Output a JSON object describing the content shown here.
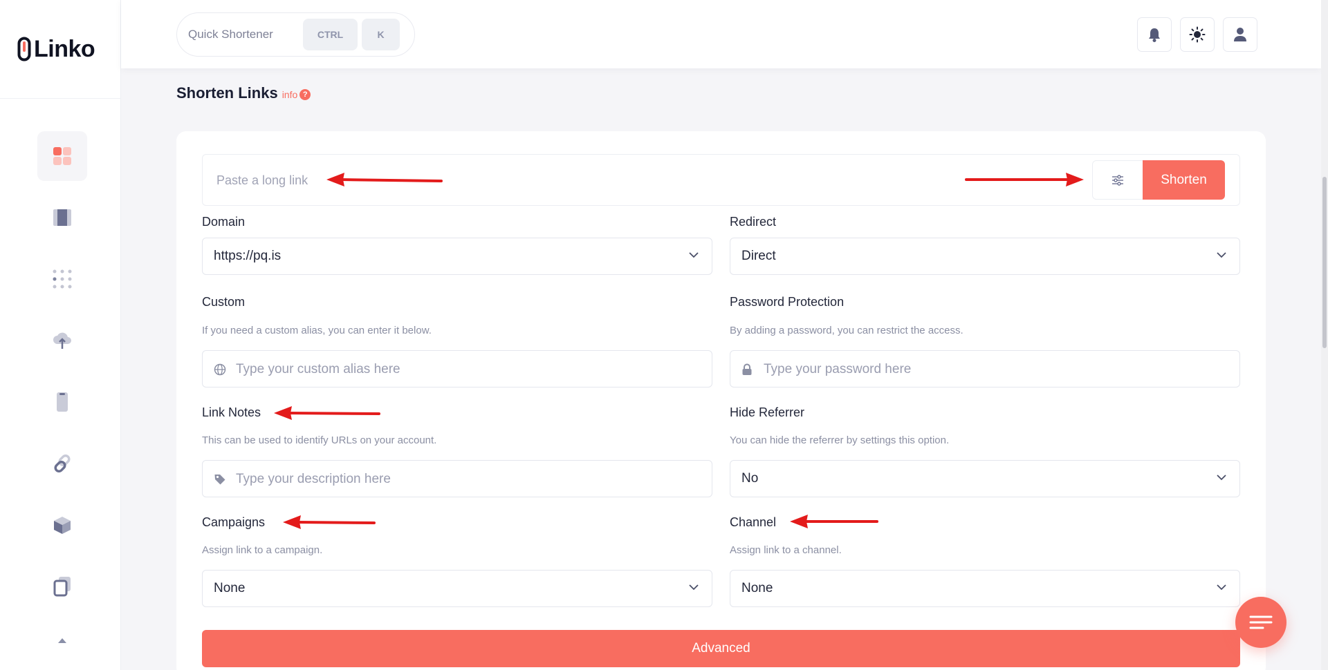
{
  "app": {
    "name": "Linko"
  },
  "topbar": {
    "quick_shortener_label": "Quick Shortener",
    "shortcut_ctrl": "CTRL",
    "shortcut_k": "K"
  },
  "page": {
    "title": "Shorten Links",
    "info_label": "info",
    "info_badge": "?"
  },
  "shorten_bar": {
    "placeholder": "Paste a long link",
    "shorten_label": "Shorten"
  },
  "form": {
    "domain": {
      "label": "Domain",
      "value": "https://pq.is"
    },
    "redirect": {
      "label": "Redirect",
      "value": "Direct"
    },
    "custom": {
      "label": "Custom",
      "help": "If you need a custom alias, you can enter it below.",
      "placeholder": "Type your custom alias here"
    },
    "password": {
      "label": "Password Protection",
      "help": "By adding a password, you can restrict the access.",
      "placeholder": "Type your password here"
    },
    "notes": {
      "label": "Link Notes",
      "help": "This can be used to identify URLs on your account.",
      "placeholder": "Type your description here"
    },
    "hide_referrer": {
      "label": "Hide Referrer",
      "help": "You can hide the referrer by settings this option.",
      "value": "No"
    },
    "campaigns": {
      "label": "Campaigns",
      "help": "Assign link to a campaign.",
      "value": "None"
    },
    "channel": {
      "label": "Channel",
      "help": "Assign link to a channel.",
      "value": "None"
    }
  },
  "advanced_label": "Advanced",
  "colors": {
    "accent": "#f86d60",
    "arrow": "#e31b1b",
    "text": "#1a1e33",
    "muted": "#8b8fa3"
  },
  "icons": {
    "sidebar": [
      "dashboard-icon",
      "book-icon",
      "grid-dots-icon",
      "cloud-upload-icon",
      "phone-icon",
      "link-icon",
      "cube-icon",
      "copy-icon"
    ],
    "topbar": [
      "bell-icon",
      "sun-icon",
      "user-icon"
    ]
  }
}
